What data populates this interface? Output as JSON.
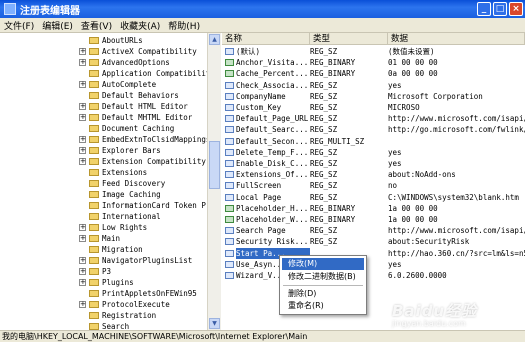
{
  "window": {
    "title": "注册表编辑器"
  },
  "menu": [
    "文件(F)",
    "编辑(E)",
    "查看(V)",
    "收藏夹(A)",
    "帮助(H)"
  ],
  "tree": [
    {
      "label": "AboutURLs",
      "expander": ""
    },
    {
      "label": "ActiveX Compatibility",
      "expander": "+"
    },
    {
      "label": "AdvancedOptions",
      "expander": "+"
    },
    {
      "label": "Application Compatibility",
      "expander": ""
    },
    {
      "label": "AutoComplete",
      "expander": "+"
    },
    {
      "label": "Default Behaviors",
      "expander": ""
    },
    {
      "label": "Default HTML Editor",
      "expander": "+"
    },
    {
      "label": "Default MHTML Editor",
      "expander": "+"
    },
    {
      "label": "Document Caching",
      "expander": ""
    },
    {
      "label": "EmbedExtnToClsidMappings",
      "expander": "+"
    },
    {
      "label": "Explorer Bars",
      "expander": "+"
    },
    {
      "label": "Extension Compatibility",
      "expander": "+"
    },
    {
      "label": "Extensions",
      "expander": ""
    },
    {
      "label": "Feed Discovery",
      "expander": ""
    },
    {
      "label": "Image Caching",
      "expander": ""
    },
    {
      "label": "InformationCard Token Prov:",
      "expander": ""
    },
    {
      "label": "International",
      "expander": ""
    },
    {
      "label": "Low Rights",
      "expander": "+"
    },
    {
      "label": "Main",
      "expander": "+"
    },
    {
      "label": "Migration",
      "expander": ""
    },
    {
      "label": "NavigatorPluginsList",
      "expander": "+"
    },
    {
      "label": "P3",
      "expander": "+"
    },
    {
      "label": "Plugins",
      "expander": "+"
    },
    {
      "label": "PrintAppletsOnFEWin95",
      "expander": ""
    },
    {
      "label": "ProtocolExecute",
      "expander": "+"
    },
    {
      "label": "Registration",
      "expander": ""
    },
    {
      "label": "Search",
      "expander": ""
    }
  ],
  "columns": {
    "name": "名称",
    "type": "类型",
    "data": "数据"
  },
  "values": [
    {
      "name": "(默认)",
      "type": "REG_SZ",
      "data": "(数值未设置)",
      "kind": "sz"
    },
    {
      "name": "Anchor_Visita...",
      "type": "REG_BINARY",
      "data": "01 00 00 00",
      "kind": "bin"
    },
    {
      "name": "Cache_Percent...",
      "type": "REG_BINARY",
      "data": "0a 00 00 00",
      "kind": "bin"
    },
    {
      "name": "Check_Associa...",
      "type": "REG_SZ",
      "data": "yes",
      "kind": "sz"
    },
    {
      "name": "CompanyName",
      "type": "REG_SZ",
      "data": "Microsoft Corporation",
      "kind": "sz"
    },
    {
      "name": "Custom_Key",
      "type": "REG_SZ",
      "data": "MICROSO",
      "kind": "sz"
    },
    {
      "name": "Default_Page_URL",
      "type": "REG_SZ",
      "data": "http://www.microsoft.com/isapi/r",
      "kind": "sz"
    },
    {
      "name": "Default_Searc...",
      "type": "REG_SZ",
      "data": "http://go.microsoft.com/fwlink/?",
      "kind": "sz"
    },
    {
      "name": "Default_Secon...",
      "type": "REG_MULTI_SZ",
      "data": "",
      "kind": "sz"
    },
    {
      "name": "Delete_Temp_F...",
      "type": "REG_SZ",
      "data": "yes",
      "kind": "sz"
    },
    {
      "name": "Enable_Disk_C...",
      "type": "REG_SZ",
      "data": "yes",
      "kind": "sz"
    },
    {
      "name": "Extensions_Of...",
      "type": "REG_SZ",
      "data": "about:NoAdd-ons",
      "kind": "sz"
    },
    {
      "name": "FullScreen",
      "type": "REG_SZ",
      "data": "no",
      "kind": "sz"
    },
    {
      "name": "Local Page",
      "type": "REG_SZ",
      "data": "C:\\WINDOWS\\system32\\blank.htm",
      "kind": "sz"
    },
    {
      "name": "Placeholder_H...",
      "type": "REG_BINARY",
      "data": "1a 00 00 00",
      "kind": "bin"
    },
    {
      "name": "Placeholder_W...",
      "type": "REG_BINARY",
      "data": "1a 00 00 00",
      "kind": "bin"
    },
    {
      "name": "Search Page",
      "type": "REG_SZ",
      "data": "http://www.microsoft.com/isapi/r",
      "kind": "sz"
    },
    {
      "name": "Security Risk...",
      "type": "REG_SZ",
      "data": "about:SecurityRisk",
      "kind": "sz"
    },
    {
      "name": "Start Pa...",
      "type": "",
      "data": "http://hao.360.cn/?src=lm&ls=n5",
      "kind": "sz"
    },
    {
      "name": "Use_Asyn...",
      "type": "",
      "data": "yes",
      "kind": "sz"
    },
    {
      "name": "Wizard_V...",
      "type": "",
      "data": "6.0.2600.0000",
      "kind": "sz"
    }
  ],
  "context_menu": [
    "修改(M)",
    "修改二进制数据(B)",
    "删除(D)",
    "重命名(R)"
  ],
  "status": "我的电脑\\HKEY_LOCAL_MACHINE\\SOFTWARE\\Microsoft\\Internet Explorer\\Main",
  "watermark": {
    "logo": "Baidu经验",
    "url": "jingyan.baidu.com"
  }
}
